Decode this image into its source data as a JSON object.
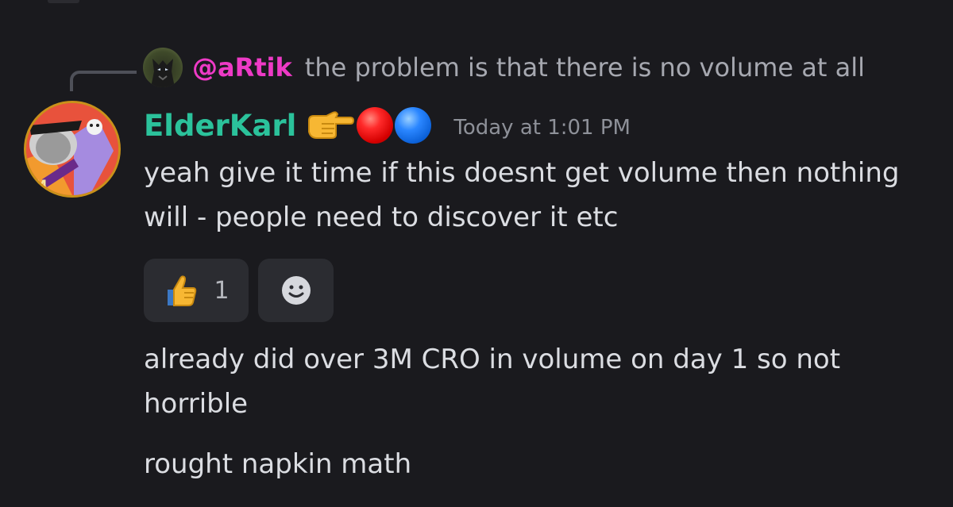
{
  "reply": {
    "mention": "@aRtik",
    "text": "the problem is that there is no volume at all"
  },
  "message": {
    "username": "ElderKarl",
    "name_emojis": [
      "pointing-right-emoji",
      "red-circle-emoji",
      "blue-circle-emoji"
    ],
    "timestamp": "Today at 1:01 PM",
    "lines": [
      "yeah give it time if this doesnt get volume then nothing will - people need to discover it etc",
      "already did over 3M CRO in volume on day 1 so not horrible",
      "rought napkin math"
    ],
    "reactions": [
      {
        "emoji": "thumbs-up-emoji",
        "count": "1"
      }
    ],
    "add_reaction_icon": "smiley-face-icon"
  },
  "colors": {
    "background": "#1a1a1e",
    "username": "#2bc29b",
    "mention": "#ee3ac6",
    "text": "#dbdde2",
    "muted": "#8e9199",
    "reaction_bg": "#2b2c31"
  }
}
